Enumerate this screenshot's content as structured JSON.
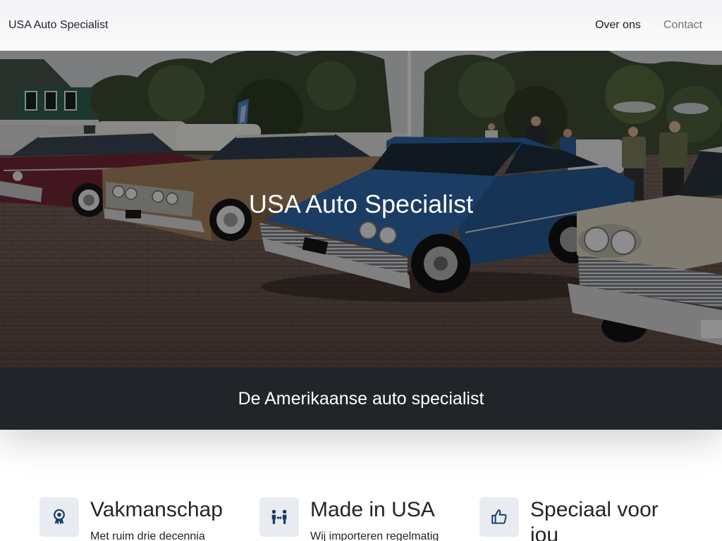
{
  "header": {
    "brand": "USA Auto Specialist",
    "nav": [
      {
        "label": "Over ons",
        "active": true
      },
      {
        "label": "Contact",
        "active": false
      }
    ]
  },
  "hero": {
    "title": "USA Auto Specialist"
  },
  "tagline": "De Amerikaanse auto specialist",
  "features": [
    {
      "icon": "award-icon",
      "title": "Vakmanschap",
      "text": "Met ruim drie decennia"
    },
    {
      "icon": "people-arrows-icon",
      "title": "Made in USA",
      "text": "Wij importeren regelmatig"
    },
    {
      "icon": "thumbs-up-icon",
      "title": "Speciaal voor jou"
    }
  ],
  "colors": {
    "text": "#212529",
    "nav_muted": "#737373",
    "band_bg": "#212529",
    "icon_bg": "#e8ecf0",
    "icon": "#163c66"
  }
}
